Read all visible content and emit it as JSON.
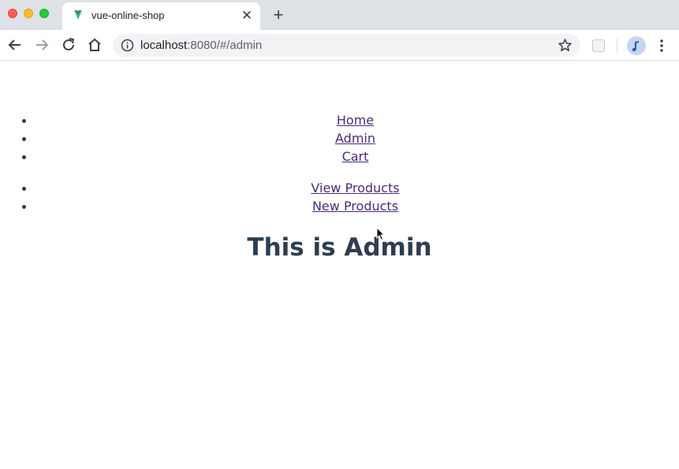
{
  "browser": {
    "tab_title": "vue-online-shop",
    "tab_close": "✕",
    "new_tab": "+",
    "url_host": "localhost",
    "url_path": ":8080/#/admin"
  },
  "nav": {
    "main_links": [
      "Home",
      "Admin",
      "Cart"
    ],
    "admin_links": [
      "View Products",
      "New Products"
    ]
  },
  "page": {
    "heading": "This is Admin"
  },
  "colors": {
    "text": "#2c3e50",
    "link": "#4b2a7a",
    "vue_green": "#42b883"
  }
}
